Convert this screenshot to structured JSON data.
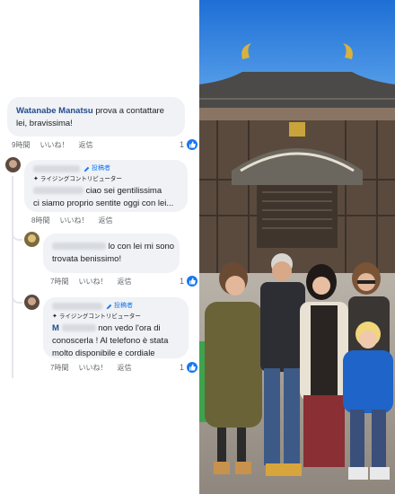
{
  "comments": [
    {
      "author": "Watanabe Manatsu",
      "text": "prova a contattare lei, bravissima!",
      "time": "9時間",
      "like_label": "いいね！",
      "reply_label": "返信",
      "reactions": "1"
    },
    {
      "author_badge": "投稿者",
      "fan_badge": "ライジングコントリビューター",
      "text_line1": "ciao sei gentilissima",
      "text_line2": "ci siamo proprio sentite oggi con lei...",
      "time": "8時間",
      "like_label": "いいね！",
      "reply_label": "返信"
    },
    {
      "text_line1": "lo con lei mi sono",
      "text_line2": "trovata benissimo!",
      "time": "7時間",
      "like_label": "いいね！",
      "reply_label": "返信",
      "reactions": "1"
    },
    {
      "author_badge": "投稿者",
      "fan_badge": "ライジングコントリビューター",
      "text_line1_prefix": "M",
      "text_line1": "non vedo l'ora di",
      "text_line2": "conoscerla ! Al telefono è stata",
      "text_line3": "molto disponibile e cordiale",
      "time": "7時間",
      "like_label": "いいね！",
      "reply_label": "返信",
      "reactions": "1"
    }
  ],
  "colors": {
    "link_blue": "#1f4c8f",
    "like_blue": "#1877f2",
    "bubble_bg": "#f0f2f5",
    "meta_gray": "#65676b"
  },
  "icons": [
    "like-icon",
    "pencil-icon",
    "star-icon",
    "avatar"
  ]
}
